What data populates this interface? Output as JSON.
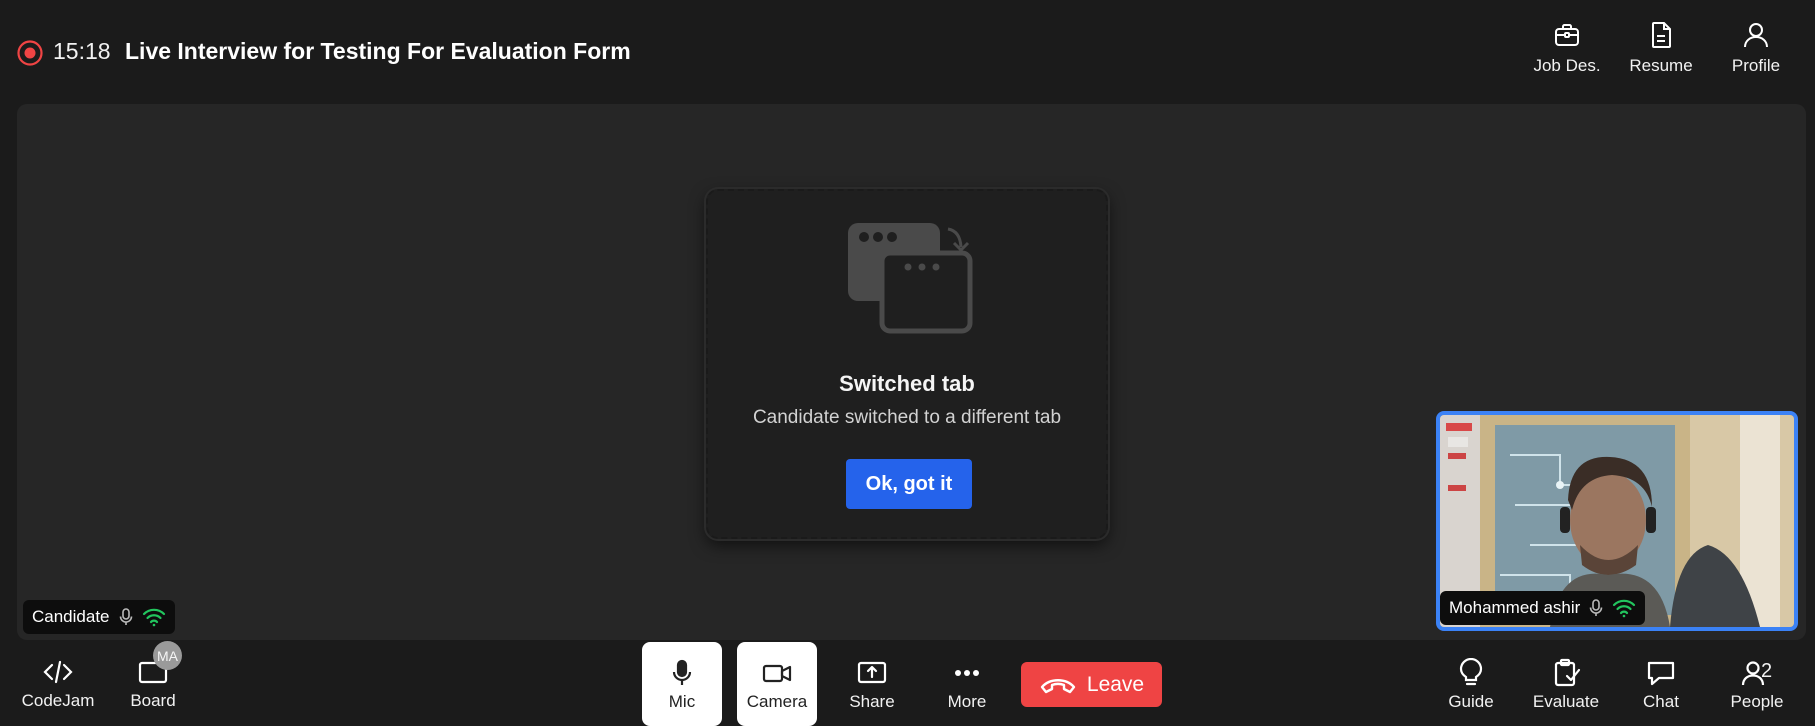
{
  "header": {
    "timer": "15:18",
    "title": "Live Interview for Testing For Evaluation Form",
    "buttons": {
      "job_description": "Job Des.",
      "resume": "Resume",
      "profile": "Profile"
    }
  },
  "modal": {
    "title": "Switched tab",
    "subtitle": "Candidate switched to a different tab",
    "ok_label": "Ok, got it"
  },
  "candidate_tag": {
    "label": "Candidate"
  },
  "self_view": {
    "name": "Mohammed ashir"
  },
  "toolbar": {
    "left": {
      "codejam": "CodeJam",
      "board": "Board",
      "board_badge": "MA"
    },
    "center": {
      "mic": "Mic",
      "camera": "Camera",
      "share": "Share",
      "more": "More",
      "leave": "Leave"
    },
    "right": {
      "guide": "Guide",
      "evaluate": "Evaluate",
      "chat": "Chat",
      "people": "People",
      "people_count": "2"
    }
  },
  "colors": {
    "background": "#1b1b1b",
    "stage": "#262626",
    "accent_blue": "#2563eb",
    "self_view_border": "#3b82f6",
    "leave_red": "#ef4444",
    "record_red": "#ef4444",
    "signal_green": "#22c55e"
  }
}
